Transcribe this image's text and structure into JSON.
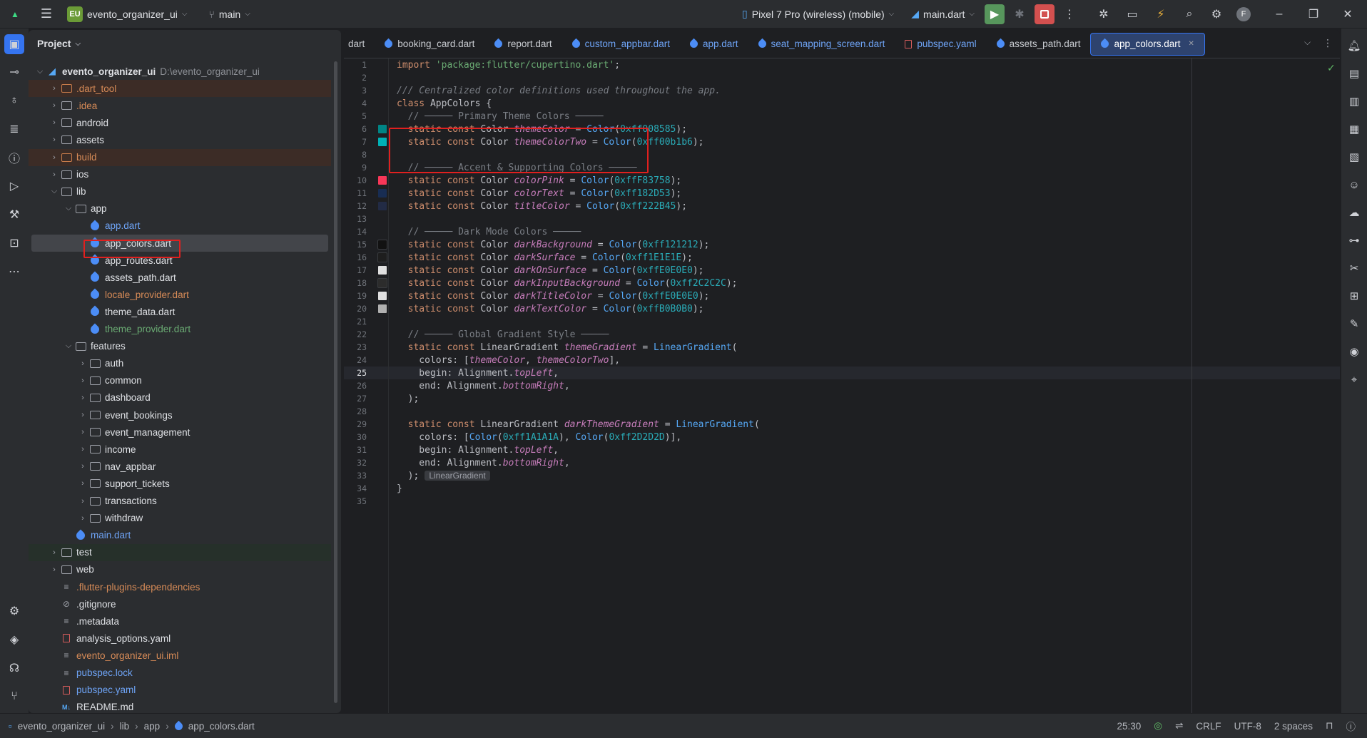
{
  "topbar": {
    "project_badge": "EU",
    "project_name": "evento_organizer_ui",
    "branch": "main",
    "device": "Pixel 7 Pro (wireless) (mobile)",
    "run_config": "main.dart",
    "avatar": "F"
  },
  "project_panel": {
    "title": "Project",
    "tree": [
      {
        "label": "evento_organizer_ui",
        "suffix": "D:\\evento_organizer_ui",
        "indent": 0,
        "arrow": "open",
        "icon": "module",
        "color": "white",
        "bold": true,
        "hl": ""
      },
      {
        "label": ".dart_tool",
        "indent": 1,
        "arrow": "closed",
        "icon": "folder-orange",
        "color": "orange",
        "hl": "brown"
      },
      {
        "label": ".idea",
        "indent": 1,
        "arrow": "closed",
        "icon": "folder",
        "color": "orange",
        "hl": ""
      },
      {
        "label": "android",
        "indent": 1,
        "arrow": "closed",
        "icon": "folder",
        "color": "white",
        "hl": ""
      },
      {
        "label": "assets",
        "indent": 1,
        "arrow": "closed",
        "icon": "folder",
        "color": "white",
        "hl": ""
      },
      {
        "label": "build",
        "indent": 1,
        "arrow": "closed",
        "icon": "folder-orange",
        "color": "orange",
        "hl": "brown"
      },
      {
        "label": "ios",
        "indent": 1,
        "arrow": "closed",
        "icon": "folder",
        "color": "white",
        "hl": ""
      },
      {
        "label": "lib",
        "indent": 1,
        "arrow": "open",
        "icon": "folder",
        "color": "white",
        "hl": ""
      },
      {
        "label": "app",
        "indent": 2,
        "arrow": "open",
        "icon": "folder",
        "color": "white",
        "hl": ""
      },
      {
        "label": "app.dart",
        "indent": 3,
        "arrow": "",
        "icon": "dart",
        "color": "blue",
        "hl": ""
      },
      {
        "label": "app_colors.dart",
        "indent": 3,
        "arrow": "",
        "icon": "dart",
        "color": "white",
        "hl": "sel"
      },
      {
        "label": "app_routes.dart",
        "indent": 3,
        "arrow": "",
        "icon": "dart",
        "color": "white",
        "hl": ""
      },
      {
        "label": "assets_path.dart",
        "indent": 3,
        "arrow": "",
        "icon": "dart",
        "color": "white",
        "hl": ""
      },
      {
        "label": "locale_provider.dart",
        "indent": 3,
        "arrow": "",
        "icon": "dart",
        "color": "orange",
        "hl": ""
      },
      {
        "label": "theme_data.dart",
        "indent": 3,
        "arrow": "",
        "icon": "dart",
        "color": "white",
        "hl": ""
      },
      {
        "label": "theme_provider.dart",
        "indent": 3,
        "arrow": "",
        "icon": "dart",
        "color": "green",
        "hl": ""
      },
      {
        "label": "features",
        "indent": 2,
        "arrow": "open",
        "icon": "folder",
        "color": "white",
        "hl": ""
      },
      {
        "label": "auth",
        "indent": 3,
        "arrow": "closed",
        "icon": "folder",
        "color": "white",
        "hl": ""
      },
      {
        "label": "common",
        "indent": 3,
        "arrow": "closed",
        "icon": "folder",
        "color": "white",
        "hl": ""
      },
      {
        "label": "dashboard",
        "indent": 3,
        "arrow": "closed",
        "icon": "folder",
        "color": "white",
        "hl": ""
      },
      {
        "label": "event_bookings",
        "indent": 3,
        "arrow": "closed",
        "icon": "folder",
        "color": "white",
        "hl": ""
      },
      {
        "label": "event_management",
        "indent": 3,
        "arrow": "closed",
        "icon": "folder",
        "color": "white",
        "hl": ""
      },
      {
        "label": "income",
        "indent": 3,
        "arrow": "closed",
        "icon": "folder",
        "color": "white",
        "hl": ""
      },
      {
        "label": "nav_appbar",
        "indent": 3,
        "arrow": "closed",
        "icon": "folder",
        "color": "white",
        "hl": ""
      },
      {
        "label": "support_tickets",
        "indent": 3,
        "arrow": "closed",
        "icon": "folder",
        "color": "white",
        "hl": ""
      },
      {
        "label": "transactions",
        "indent": 3,
        "arrow": "closed",
        "icon": "folder",
        "color": "white",
        "hl": ""
      },
      {
        "label": "withdraw",
        "indent": 3,
        "arrow": "closed",
        "icon": "folder",
        "color": "white",
        "hl": ""
      },
      {
        "label": "main.dart",
        "indent": 2,
        "arrow": "",
        "icon": "dart",
        "color": "blue",
        "hl": ""
      },
      {
        "label": "test",
        "indent": 1,
        "arrow": "closed",
        "icon": "folder",
        "color": "white",
        "hl": "green"
      },
      {
        "label": "web",
        "indent": 1,
        "arrow": "closed",
        "icon": "folder",
        "color": "white",
        "hl": ""
      },
      {
        "label": ".flutter-plugins-dependencies",
        "indent": 1,
        "arrow": "",
        "icon": "lines",
        "color": "orange",
        "hl": ""
      },
      {
        "label": ".gitignore",
        "indent": 1,
        "arrow": "",
        "icon": "ignore",
        "color": "white",
        "hl": ""
      },
      {
        "label": ".metadata",
        "indent": 1,
        "arrow": "",
        "icon": "lines",
        "color": "white",
        "hl": ""
      },
      {
        "label": "analysis_options.yaml",
        "indent": 1,
        "arrow": "",
        "icon": "yaml",
        "color": "white",
        "hl": ""
      },
      {
        "label": "evento_organizer_ui.iml",
        "indent": 1,
        "arrow": "",
        "icon": "lines",
        "color": "orange",
        "hl": ""
      },
      {
        "label": "pubspec.lock",
        "indent": 1,
        "arrow": "",
        "icon": "lines",
        "color": "blue",
        "hl": ""
      },
      {
        "label": "pubspec.yaml",
        "indent": 1,
        "arrow": "",
        "icon": "yaml",
        "color": "blue",
        "hl": ""
      },
      {
        "label": "README.md",
        "indent": 1,
        "arrow": "",
        "icon": "md",
        "color": "white",
        "hl": ""
      }
    ]
  },
  "tabs": [
    {
      "label": "dart",
      "icon": "none"
    },
    {
      "label": "booking_card.dart",
      "icon": "dart"
    },
    {
      "label": "report.dart",
      "icon": "dart"
    },
    {
      "label": "custom_appbar.dart",
      "icon": "dart",
      "color": "blue"
    },
    {
      "label": "app.dart",
      "icon": "dart",
      "color": "blue"
    },
    {
      "label": "seat_mapping_screen.dart",
      "icon": "dart",
      "color": "blue"
    },
    {
      "label": "pubspec.yaml",
      "icon": "yaml",
      "color": "blue"
    },
    {
      "label": "assets_path.dart",
      "icon": "dart"
    },
    {
      "label": "app_colors.dart",
      "icon": "dart",
      "active": true
    }
  ],
  "code": {
    "current_line": 25,
    "lines": [
      [
        [
          "kw",
          "import "
        ],
        [
          "str",
          "'package:flutter/cupertino.dart'"
        ],
        [
          "",
          "; "
        ]
      ],
      [],
      [
        [
          "cm",
          "/// Centralized color definitions used throughout the app."
        ]
      ],
      [
        [
          "kw",
          "class "
        ],
        [
          "cls",
          "AppColors "
        ],
        [
          "",
          "{"
        ]
      ],
      [
        [
          "cm2",
          "  // ───── Primary Theme Colors ─────"
        ]
      ],
      [
        [
          "kw",
          "  static const "
        ],
        [
          "cls",
          "Color "
        ],
        [
          "fld",
          "themeColor"
        ],
        [
          "",
          " = "
        ],
        [
          "fn",
          "Color"
        ],
        [
          "",
          "("
        ],
        [
          "num",
          "0xff008585"
        ],
        [
          "",
          ");"
        ]
      ],
      [
        [
          "kw",
          "  static const "
        ],
        [
          "cls",
          "Color "
        ],
        [
          "fld",
          "themeColorTwo"
        ],
        [
          "",
          " = "
        ],
        [
          "fn",
          "Color"
        ],
        [
          "",
          "("
        ],
        [
          "num",
          "0xff00b1b6"
        ],
        [
          "",
          ");"
        ]
      ],
      [],
      [
        [
          "cm2",
          "  // ───── Accent & Supporting Colors ─────"
        ]
      ],
      [
        [
          "kw",
          "  static const "
        ],
        [
          "cls",
          "Color "
        ],
        [
          "fld",
          "colorPink"
        ],
        [
          "",
          " = "
        ],
        [
          "fn",
          "Color"
        ],
        [
          "",
          "("
        ],
        [
          "num",
          "0xffF83758"
        ],
        [
          "",
          ");"
        ]
      ],
      [
        [
          "kw",
          "  static const "
        ],
        [
          "cls",
          "Color "
        ],
        [
          "fld",
          "colorText"
        ],
        [
          "",
          " = "
        ],
        [
          "fn",
          "Color"
        ],
        [
          "",
          "("
        ],
        [
          "num",
          "0xff182D53"
        ],
        [
          "",
          ");"
        ]
      ],
      [
        [
          "kw",
          "  static const "
        ],
        [
          "cls",
          "Color "
        ],
        [
          "fld",
          "titleColor"
        ],
        [
          "",
          " = "
        ],
        [
          "fn",
          "Color"
        ],
        [
          "",
          "("
        ],
        [
          "num",
          "0xff222B45"
        ],
        [
          "",
          ");"
        ]
      ],
      [],
      [
        [
          "cm2",
          "  // ───── Dark Mode Colors ─────"
        ]
      ],
      [
        [
          "kw",
          "  static const "
        ],
        [
          "cls",
          "Color "
        ],
        [
          "fld",
          "darkBackground"
        ],
        [
          "",
          " = "
        ],
        [
          "fn",
          "Color"
        ],
        [
          "",
          "("
        ],
        [
          "num",
          "0xff121212"
        ],
        [
          "",
          ");"
        ]
      ],
      [
        [
          "kw",
          "  static const "
        ],
        [
          "cls",
          "Color "
        ],
        [
          "fld",
          "darkSurface"
        ],
        [
          "",
          " = "
        ],
        [
          "fn",
          "Color"
        ],
        [
          "",
          "("
        ],
        [
          "num",
          "0xff1E1E1E"
        ],
        [
          "",
          ");"
        ]
      ],
      [
        [
          "kw",
          "  static const "
        ],
        [
          "cls",
          "Color "
        ],
        [
          "fld",
          "darkOnSurface"
        ],
        [
          "",
          " = "
        ],
        [
          "fn",
          "Color"
        ],
        [
          "",
          "("
        ],
        [
          "num",
          "0xffE0E0E0"
        ],
        [
          "",
          ");"
        ]
      ],
      [
        [
          "kw",
          "  static const "
        ],
        [
          "cls",
          "Color "
        ],
        [
          "fld",
          "darkInputBackground"
        ],
        [
          "",
          " = "
        ],
        [
          "fn",
          "Color"
        ],
        [
          "",
          "("
        ],
        [
          "num",
          "0xff2C2C2C"
        ],
        [
          "",
          ");"
        ]
      ],
      [
        [
          "kw",
          "  static const "
        ],
        [
          "cls",
          "Color "
        ],
        [
          "fld",
          "darkTitleColor"
        ],
        [
          "",
          " = "
        ],
        [
          "fn",
          "Color"
        ],
        [
          "",
          "("
        ],
        [
          "num",
          "0xffE0E0E0"
        ],
        [
          "",
          ");"
        ]
      ],
      [
        [
          "kw",
          "  static const "
        ],
        [
          "cls",
          "Color "
        ],
        [
          "fld",
          "darkTextColor"
        ],
        [
          "",
          " = "
        ],
        [
          "fn",
          "Color"
        ],
        [
          "",
          "("
        ],
        [
          "num",
          "0xffB0B0B0"
        ],
        [
          "",
          ");"
        ]
      ],
      [],
      [
        [
          "cm2",
          "  // ───── Global Gradient Style ─────"
        ]
      ],
      [
        [
          "kw",
          "  static const "
        ],
        [
          "cls",
          "LinearGradient "
        ],
        [
          "fld",
          "themeGradient"
        ],
        [
          "",
          " = "
        ],
        [
          "fn",
          "LinearGradient"
        ],
        [
          "",
          "("
        ]
      ],
      [
        [
          "",
          "    colors: ["
        ],
        [
          "fld",
          "themeColor"
        ],
        [
          "",
          ", "
        ],
        [
          "fld",
          "themeColorTwo"
        ],
        [
          "",
          "],"
        ]
      ],
      [
        [
          "",
          "    begin: Alignment."
        ],
        [
          "fld",
          "topLeft"
        ],
        [
          "",
          ","
        ]
      ],
      [
        [
          "",
          "    end: Alignment."
        ],
        [
          "fld",
          "bottomRight"
        ],
        [
          "",
          ","
        ]
      ],
      [
        [
          "",
          "  );"
        ]
      ],
      [],
      [
        [
          "kw",
          "  static const "
        ],
        [
          "cls",
          "LinearGradient "
        ],
        [
          "fld",
          "darkThemeGradient"
        ],
        [
          "",
          " = "
        ],
        [
          "fn",
          "LinearGradient"
        ],
        [
          "",
          "("
        ]
      ],
      [
        [
          "",
          "    colors: ["
        ],
        [
          "fn",
          "Color"
        ],
        [
          "",
          "("
        ],
        [
          "num",
          "0xff1A1A1A"
        ],
        [
          "",
          "), "
        ],
        [
          "fn",
          "Color"
        ],
        [
          "",
          "("
        ],
        [
          "num",
          "0xff2D2D2D"
        ],
        [
          "",
          ")],"
        ]
      ],
      [
        [
          "",
          "    begin: Alignment."
        ],
        [
          "fld",
          "topLeft"
        ],
        [
          "",
          ","
        ]
      ],
      [
        [
          "",
          "    end: Alignment."
        ],
        [
          "fld",
          "bottomRight"
        ],
        [
          "",
          ","
        ]
      ],
      [
        [
          "",
          "  );"
        ],
        [
          "hint",
          "LinearGradient"
        ]
      ],
      [
        [
          "",
          "}"
        ]
      ],
      []
    ],
    "swatches": {
      "6": "#008585",
      "7": "#00b1b6",
      "10": "#F83758",
      "11": "#182D53",
      "12": "#222B45",
      "15": "#121212",
      "16": "#1E1E1E",
      "17": "#E0E0E0",
      "18": "#2C2C2C",
      "19": "#E0E0E0",
      "20": "#B0B0B0"
    }
  },
  "statusbar": {
    "crumbs": [
      "evento_organizer_ui",
      "lib",
      "app",
      "app_colors.dart"
    ],
    "position": "25:30",
    "line_ending": "CRLF",
    "encoding": "UTF-8",
    "indent": "2 spaces"
  },
  "colors": {
    "accent": "#3574f0",
    "highlight_box": "#e0201f"
  }
}
